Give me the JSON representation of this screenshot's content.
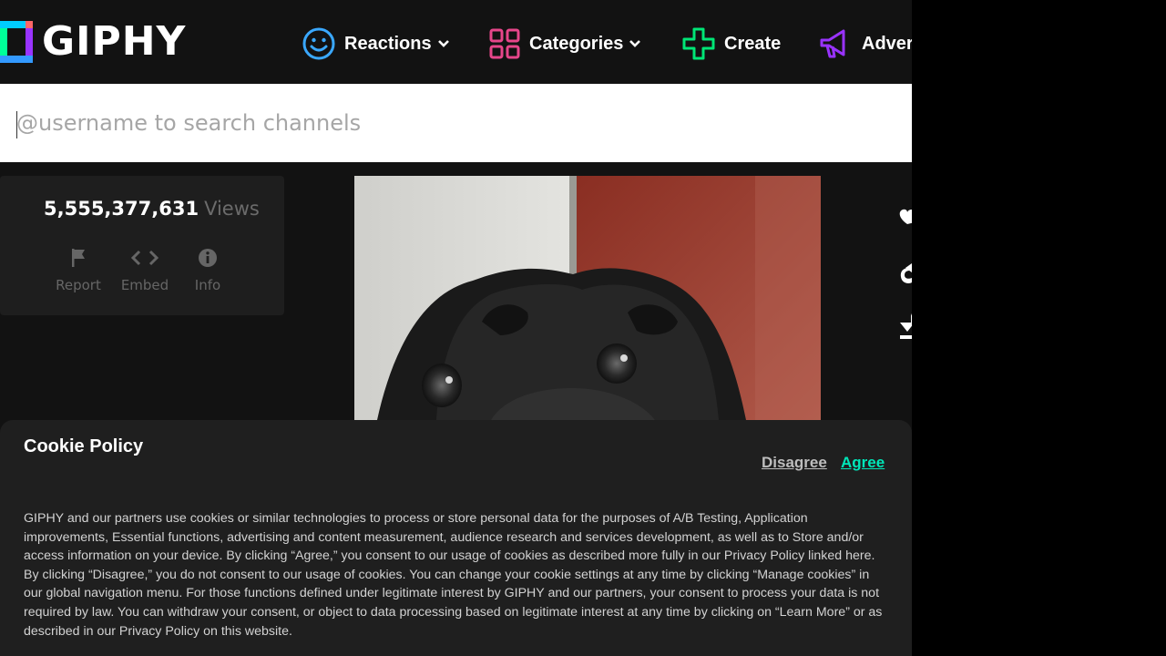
{
  "brand": {
    "name": "GIPHY"
  },
  "nav": {
    "items": [
      {
        "label": "Reactions",
        "icon": "smiley-icon",
        "color": "#3aa8ff"
      },
      {
        "label": "Categories",
        "icon": "grid-icon",
        "color": "#e6468a"
      },
      {
        "label": "Create",
        "icon": "plus-icon",
        "color": "#00e676"
      },
      {
        "label": "Adver",
        "icon": "megaphone-icon",
        "color": "#9933ff"
      }
    ]
  },
  "search": {
    "placeholder": "@username to search channels",
    "value": ""
  },
  "stats": {
    "views_count": "5,555,377,631",
    "views_label": "Views"
  },
  "actions": [
    {
      "label": "Report",
      "icon": "flag-icon"
    },
    {
      "label": "Embed",
      "icon": "code-icon"
    },
    {
      "label": "Info",
      "icon": "info-icon"
    }
  ],
  "side_actions": [
    {
      "icon": "heart-icon"
    },
    {
      "icon": "share-icon"
    },
    {
      "icon": "download-icon"
    }
  ],
  "cookie": {
    "title": "Cookie Policy",
    "disagree": "Disagree",
    "agree": "Agree",
    "body": "GIPHY and our partners use cookies or similar technologies to process or store personal data for the purposes of A/B Testing, Application improvements, Essential functions, advertising and content measurement, audience research and services development, as well as to Store and/or access information on your device. By clicking “Agree,” you consent to our usage of cookies as described more fully in our Privacy Policy linked here. By clicking “Disagree,” you do not consent to our usage of cookies. You can change your cookie settings at any time by clicking “Manage cookies” in our global navigation menu. For those functions defined under legitimate interest by GIPHY and our partners, your consent to process your data is not required by law. You can withdraw your consent, or object to data processing based on legitimate interest at any time by clicking on “Learn More” or as described in our Privacy Policy on this website."
  },
  "colors": {
    "agree": "#00e6b8",
    "background": "#121212"
  }
}
